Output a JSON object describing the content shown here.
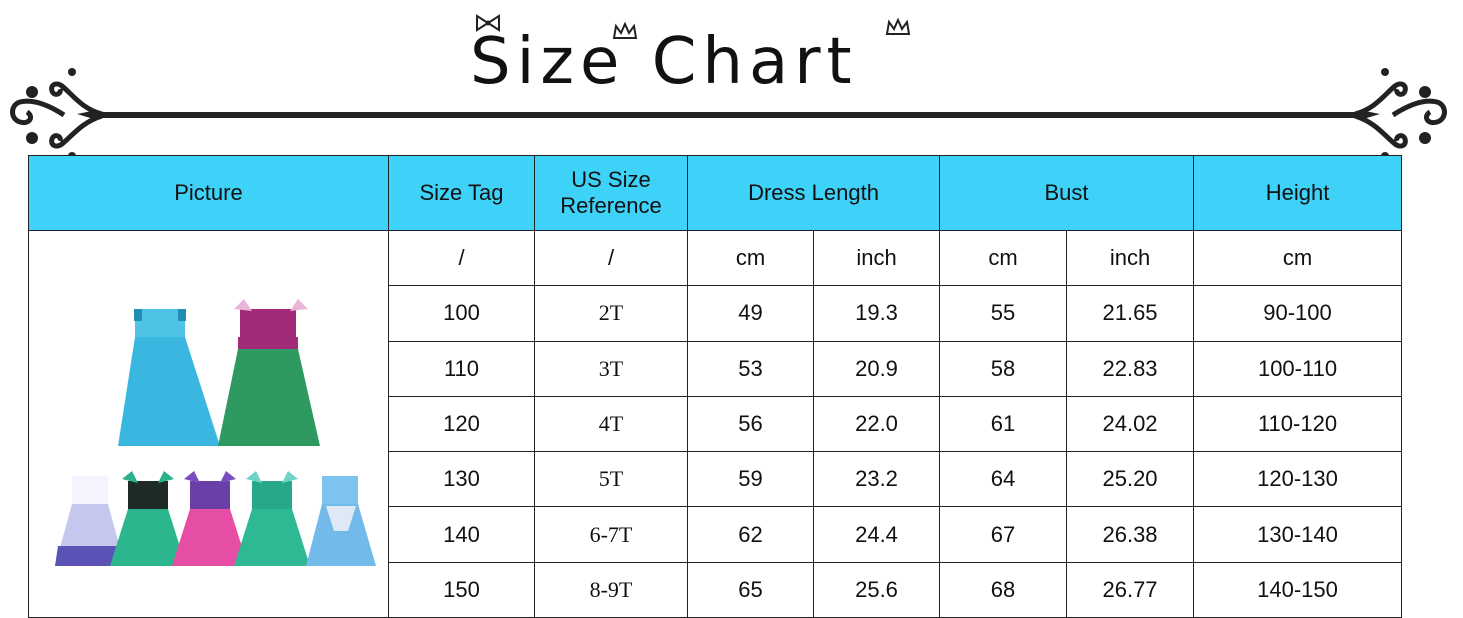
{
  "title": "Size Chart",
  "accent_color": "#3ed2f9",
  "table": {
    "headers": {
      "picture": "Picture",
      "size_tag": "Size Tag",
      "us_size_line1": "US Size",
      "us_size_line2": "Reference",
      "dress_length": "Dress Length",
      "bust": "Bust",
      "height": "Height"
    },
    "units": {
      "size_tag": "/",
      "us_size": "/",
      "dress_cm": "cm",
      "dress_inch": "inch",
      "bust_cm": "cm",
      "bust_inch": "inch",
      "height": "cm"
    },
    "rows": [
      {
        "size": "100",
        "us": "2T",
        "len_cm": "49",
        "len_in": "19.3",
        "bust_cm": "55",
        "bust_in": "21.65",
        "height": "90-100"
      },
      {
        "size": "110",
        "us": "3T",
        "len_cm": "53",
        "len_in": "20.9",
        "bust_cm": "58",
        "bust_in": "22.83",
        "height": "100-110"
      },
      {
        "size": "120",
        "us": "4T",
        "len_cm": "56",
        "len_in": "22.0",
        "bust_cm": "61",
        "bust_in": "24.02",
        "height": "110-120"
      },
      {
        "size": "130",
        "us": "5T",
        "len_cm": "59",
        "len_in": "23.2",
        "bust_cm": "64",
        "bust_in": "25.20",
        "height": "120-130"
      },
      {
        "size": "140",
        "us": "6-7T",
        "len_cm": "62",
        "len_in": "24.4",
        "bust_cm": "67",
        "bust_in": "26.38",
        "height": "130-140"
      },
      {
        "size": "150",
        "us": "8-9T",
        "len_cm": "65",
        "len_in": "25.6",
        "bust_cm": "68",
        "bust_in": "26.77",
        "height": "140-150"
      }
    ]
  },
  "picture_icons": [
    "blue-dress-icon",
    "green-mermaid-dress-icon",
    "white-purple-dress-icon",
    "green-black-dress-icon",
    "purple-pink-dress-icon",
    "teal-dress-icon",
    "light-blue-dress-icon"
  ]
}
